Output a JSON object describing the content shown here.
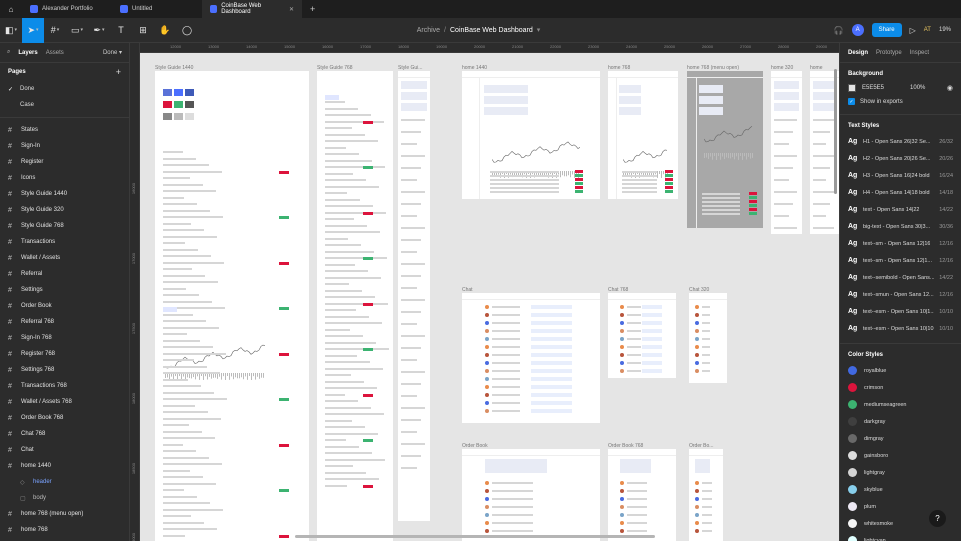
{
  "os_tabs": [
    {
      "label": "Alexander Portfolio",
      "active": false
    },
    {
      "label": "Untitled",
      "active": false
    },
    {
      "label": "CoinBase Web Dashboard",
      "active": true
    }
  ],
  "toolbar": {
    "project": "Archive",
    "file": "CoinBase Web Dashboard",
    "share_label": "Share",
    "avatar_initial": "A",
    "ai_label": "AT",
    "zoom": "19%"
  },
  "left_panel": {
    "tabs": [
      "Layers",
      "Assets"
    ],
    "done_label": "Done",
    "pages_title": "Pages",
    "pages": [
      {
        "label": "Done",
        "checked": true
      },
      {
        "label": "Case",
        "checked": false
      }
    ],
    "layers": [
      {
        "label": "States"
      },
      {
        "label": "Sign-In"
      },
      {
        "label": "Register"
      },
      {
        "label": "Icons"
      },
      {
        "label": "Style Guide 1440"
      },
      {
        "label": "Style Guide 320"
      },
      {
        "label": "Style Guide 768"
      },
      {
        "label": "Transactions"
      },
      {
        "label": "Wallet / Assets"
      },
      {
        "label": "Referral"
      },
      {
        "label": "Settings"
      },
      {
        "label": "Order Book"
      },
      {
        "label": "Referral 768"
      },
      {
        "label": "Sign-In 768"
      },
      {
        "label": "Register 768"
      },
      {
        "label": "Settings 768"
      },
      {
        "label": "Transactions 768"
      },
      {
        "label": "Wallet / Assets 768"
      },
      {
        "label": "Order Book 768"
      },
      {
        "label": "Chat 768"
      },
      {
        "label": "Chat"
      },
      {
        "label": "home 1440"
      }
    ],
    "children": [
      {
        "label": "header",
        "selected": true
      },
      {
        "label": "body",
        "selected": false
      }
    ],
    "layers_after": [
      {
        "label": "home 768 (menu open)"
      },
      {
        "label": "home 768"
      }
    ]
  },
  "canvas": {
    "frames": [
      {
        "label": "Style Guide 1440"
      },
      {
        "label": "Style Guide 768"
      },
      {
        "label": "Style Gui..."
      },
      {
        "label": "home 1440"
      },
      {
        "label": "home 768"
      },
      {
        "label": "home 768 (menu open)"
      },
      {
        "label": "home 320"
      },
      {
        "label": "home"
      },
      {
        "label": "Chat"
      },
      {
        "label": "Chat 768"
      },
      {
        "label": "Chat 320"
      },
      {
        "label": "Order Book"
      },
      {
        "label": "Order Book 768"
      },
      {
        "label": "Order Bo..."
      }
    ],
    "ruler_h": [
      "12000",
      "13000",
      "14000",
      "15000",
      "16000",
      "17000",
      "18000",
      "19000",
      "20000",
      "21000",
      "22000",
      "23000",
      "24000",
      "25000",
      "26000",
      "27000",
      "28000",
      "29000"
    ],
    "ruler_v": [
      "16000",
      "17000",
      "17500",
      "18000",
      "18500",
      "19000"
    ]
  },
  "right_panel": {
    "tabs": [
      "Design",
      "Prototype",
      "Inspect"
    ],
    "background_title": "Background",
    "background_hex": "E5E5E5",
    "background_opacity": "100%",
    "show_in_exports": "Show in exports",
    "text_styles_title": "Text Styles",
    "text_styles": [
      {
        "name": "H1 - Open Sans 26|32 Se...",
        "size": "26/32"
      },
      {
        "name": "H2 - Open Sans 20|26 Se...",
        "size": "20/26"
      },
      {
        "name": "H3 - Open Sans 16|24 bold",
        "size": "16/24"
      },
      {
        "name": "H4 - Open Sans 14|18 bold",
        "size": "14/18"
      },
      {
        "name": "text - Open Sans 14|22",
        "size": "14/22"
      },
      {
        "name": "big-text - Open Sans 30|3...",
        "size": "30/36"
      },
      {
        "name": "text--sm - Open Sans 12|16",
        "size": "12/16"
      },
      {
        "name": "text--sm - Open Sans 12|1...",
        "size": "12/16"
      },
      {
        "name": "text--semibold - Open Sans...",
        "size": "14/22"
      },
      {
        "name": "text--smun - Open Sans 12...",
        "size": "12/16"
      },
      {
        "name": "text--esm - Open Sans 10|1...",
        "size": "10/10"
      },
      {
        "name": "text--esm - Open Sans 10|10",
        "size": "10/10"
      }
    ],
    "color_styles_title": "Color Styles",
    "color_styles": [
      {
        "name": "royalblue",
        "color": "#4169e1"
      },
      {
        "name": "crimson",
        "color": "#dc143c"
      },
      {
        "name": "mediumseagreen",
        "color": "#3cb371"
      },
      {
        "name": "darkgray",
        "color": "#3f3f3f"
      },
      {
        "name": "dimgray",
        "color": "#696969"
      },
      {
        "name": "gainsboro",
        "color": "#dcdcdc"
      },
      {
        "name": "lightgray",
        "color": "#d3d3d3"
      },
      {
        "name": "skyblue",
        "color": "#87ceeb"
      },
      {
        "name": "plum",
        "color": "#ece8f3"
      },
      {
        "name": "whitesmoke",
        "color": "#f5f5f5"
      },
      {
        "name": "lightcyan",
        "color": "#e0ffff"
      }
    ]
  }
}
